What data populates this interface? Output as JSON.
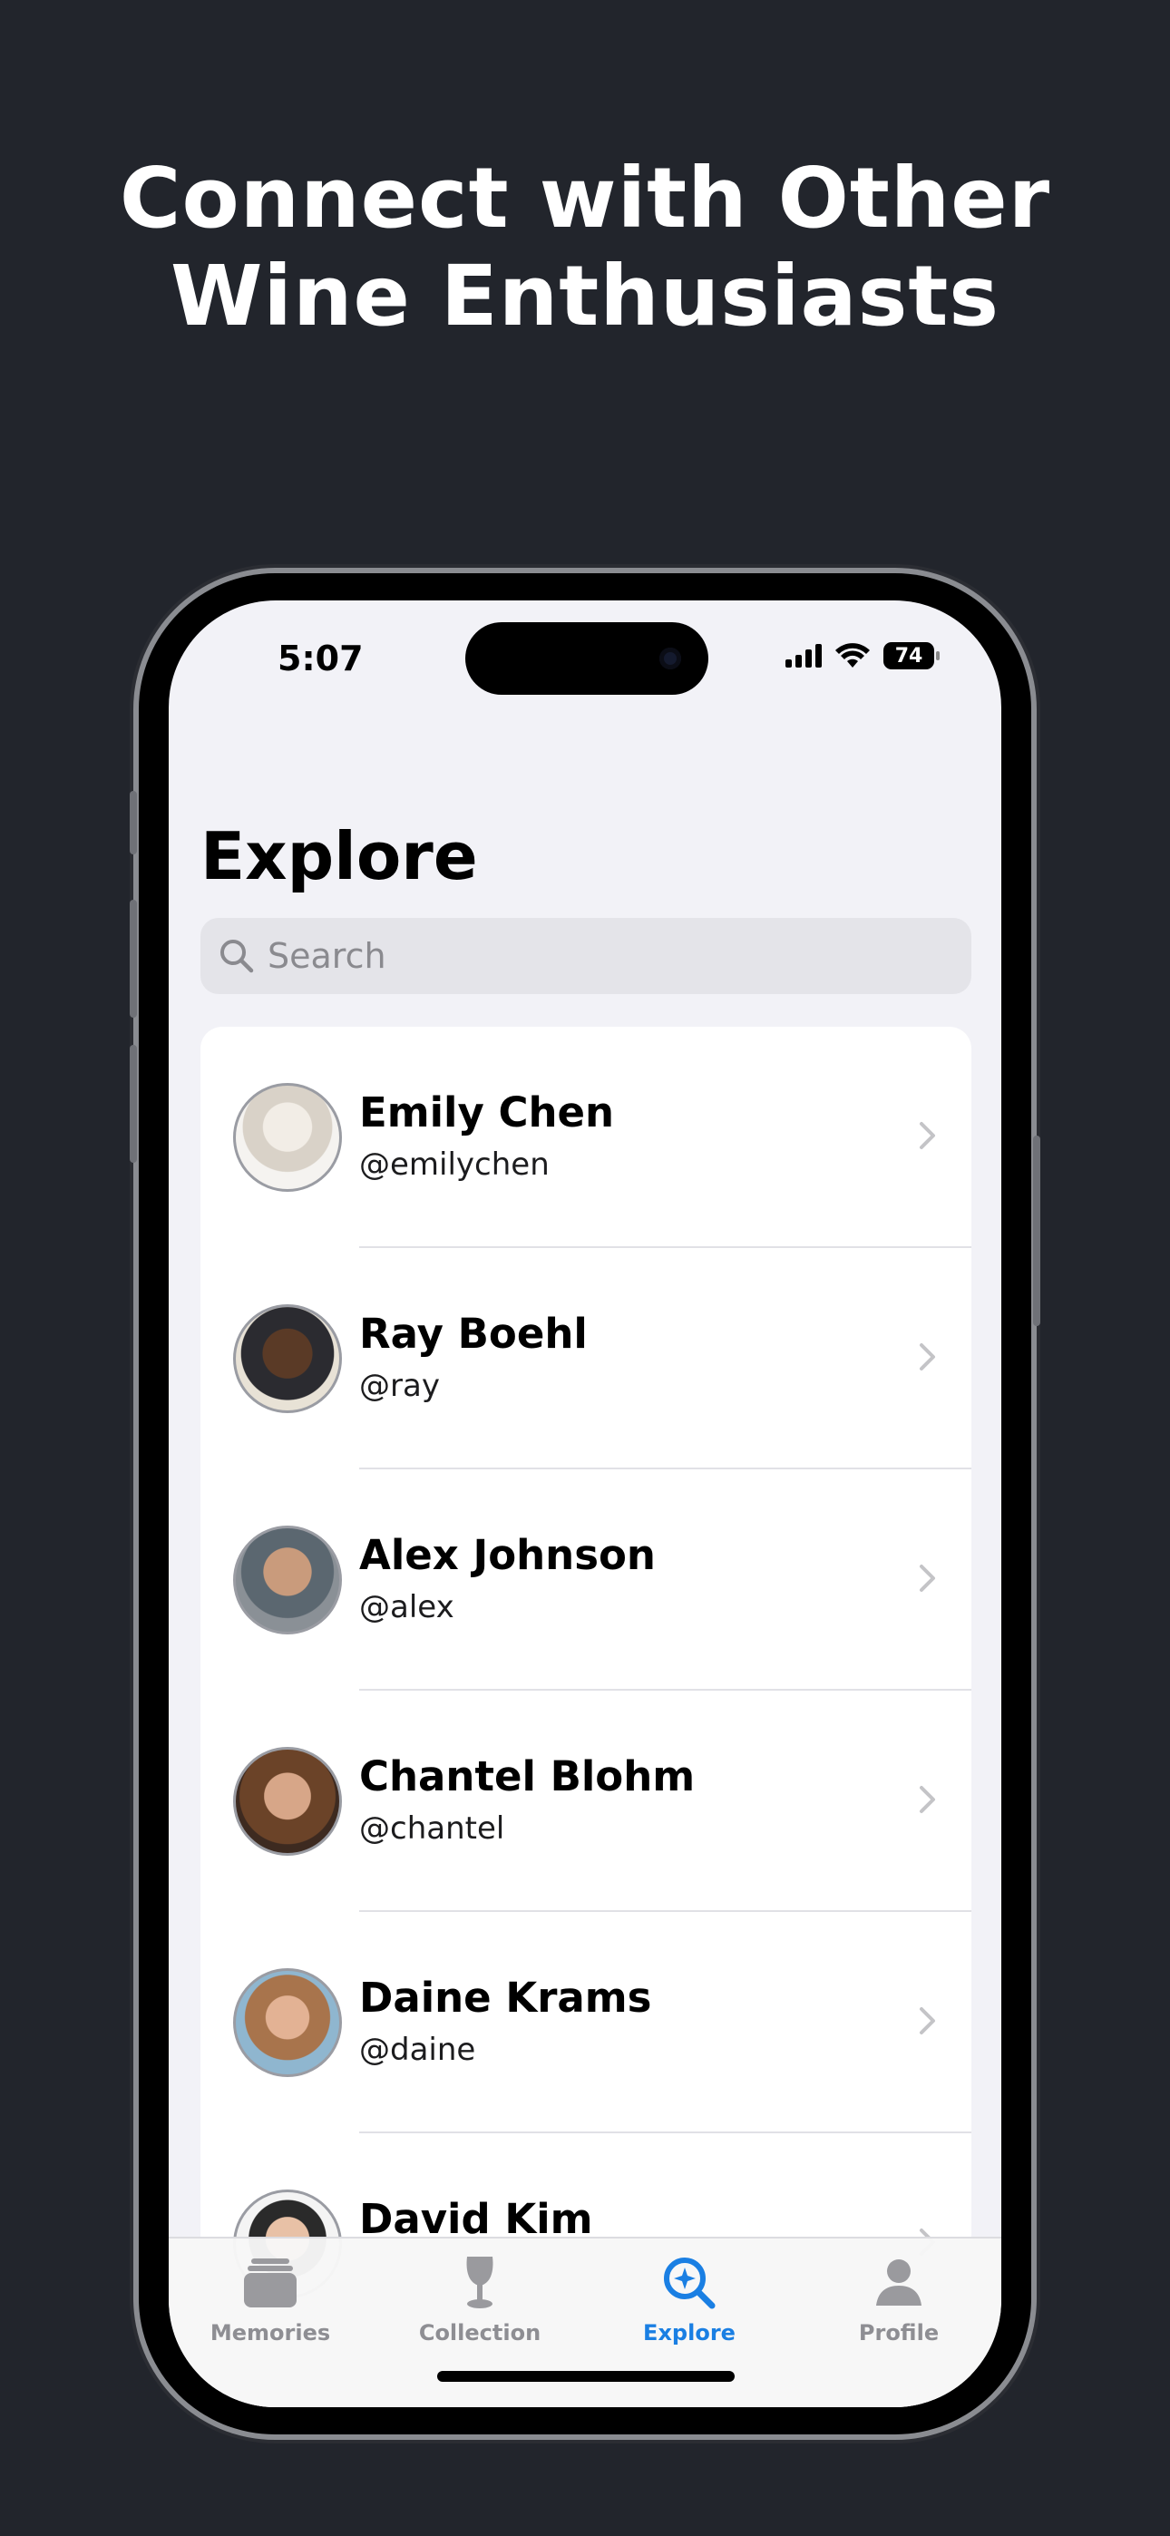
{
  "headline": {
    "line1": "Connect with Other",
    "line2": "Wine Enthusiasts"
  },
  "status_bar": {
    "time": "5:07",
    "battery": "74"
  },
  "page": {
    "title": "Explore"
  },
  "search": {
    "placeholder": "Search"
  },
  "users": [
    {
      "name": "Emily Chen",
      "handle": "@emilychen"
    },
    {
      "name": "Ray Boehl",
      "handle": "@ray"
    },
    {
      "name": "Alex Johnson",
      "handle": "@alex"
    },
    {
      "name": "Chantel Blohm",
      "handle": "@chantel"
    },
    {
      "name": "Daine Krams",
      "handle": "@daine"
    },
    {
      "name": "David Kim",
      "handle": ""
    }
  ],
  "tabs": [
    {
      "label": "Memories",
      "icon": "memories-icon",
      "active": false
    },
    {
      "label": "Collection",
      "icon": "wine-glass-icon",
      "active": false
    },
    {
      "label": "Explore",
      "icon": "explore-icon",
      "active": true
    },
    {
      "label": "Profile",
      "icon": "person-icon",
      "active": false
    }
  ],
  "colors": {
    "background": "#22252c",
    "accent": "#1a7fe3",
    "screen_bg": "#f2f2f7"
  }
}
